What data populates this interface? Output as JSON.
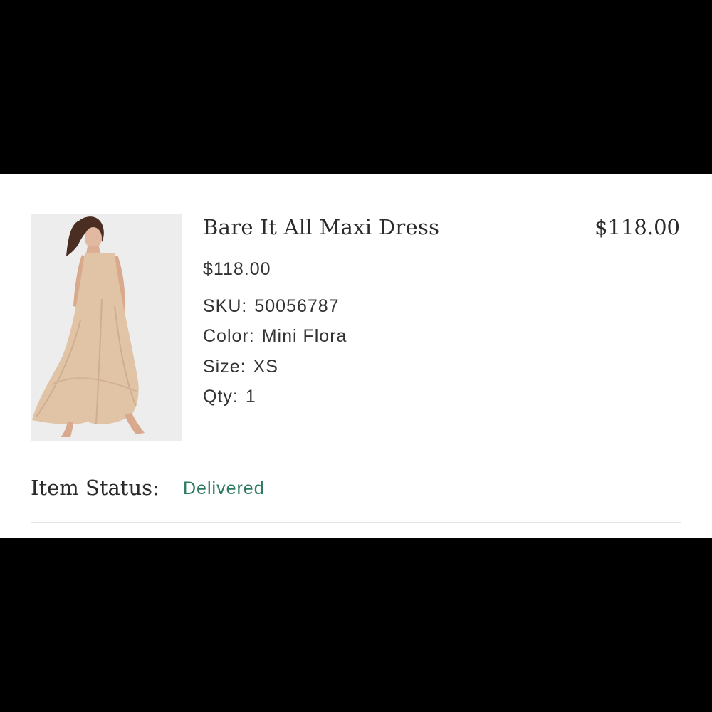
{
  "order_item": {
    "title": "Bare It All Maxi Dress",
    "line_total": "$118.00",
    "unit_price": "$118.00",
    "sku_label": "SKU:",
    "sku_value": "50056787",
    "color_label": "Color:",
    "color_value": "Mini Flora",
    "size_label": "Size:",
    "size_value": "XS",
    "qty_label": "Qty:",
    "qty_value": "1",
    "image_icon": "product-photo"
  },
  "status": {
    "label": "Item Status:",
    "value": "Delivered",
    "color": "#2e7a5f"
  }
}
